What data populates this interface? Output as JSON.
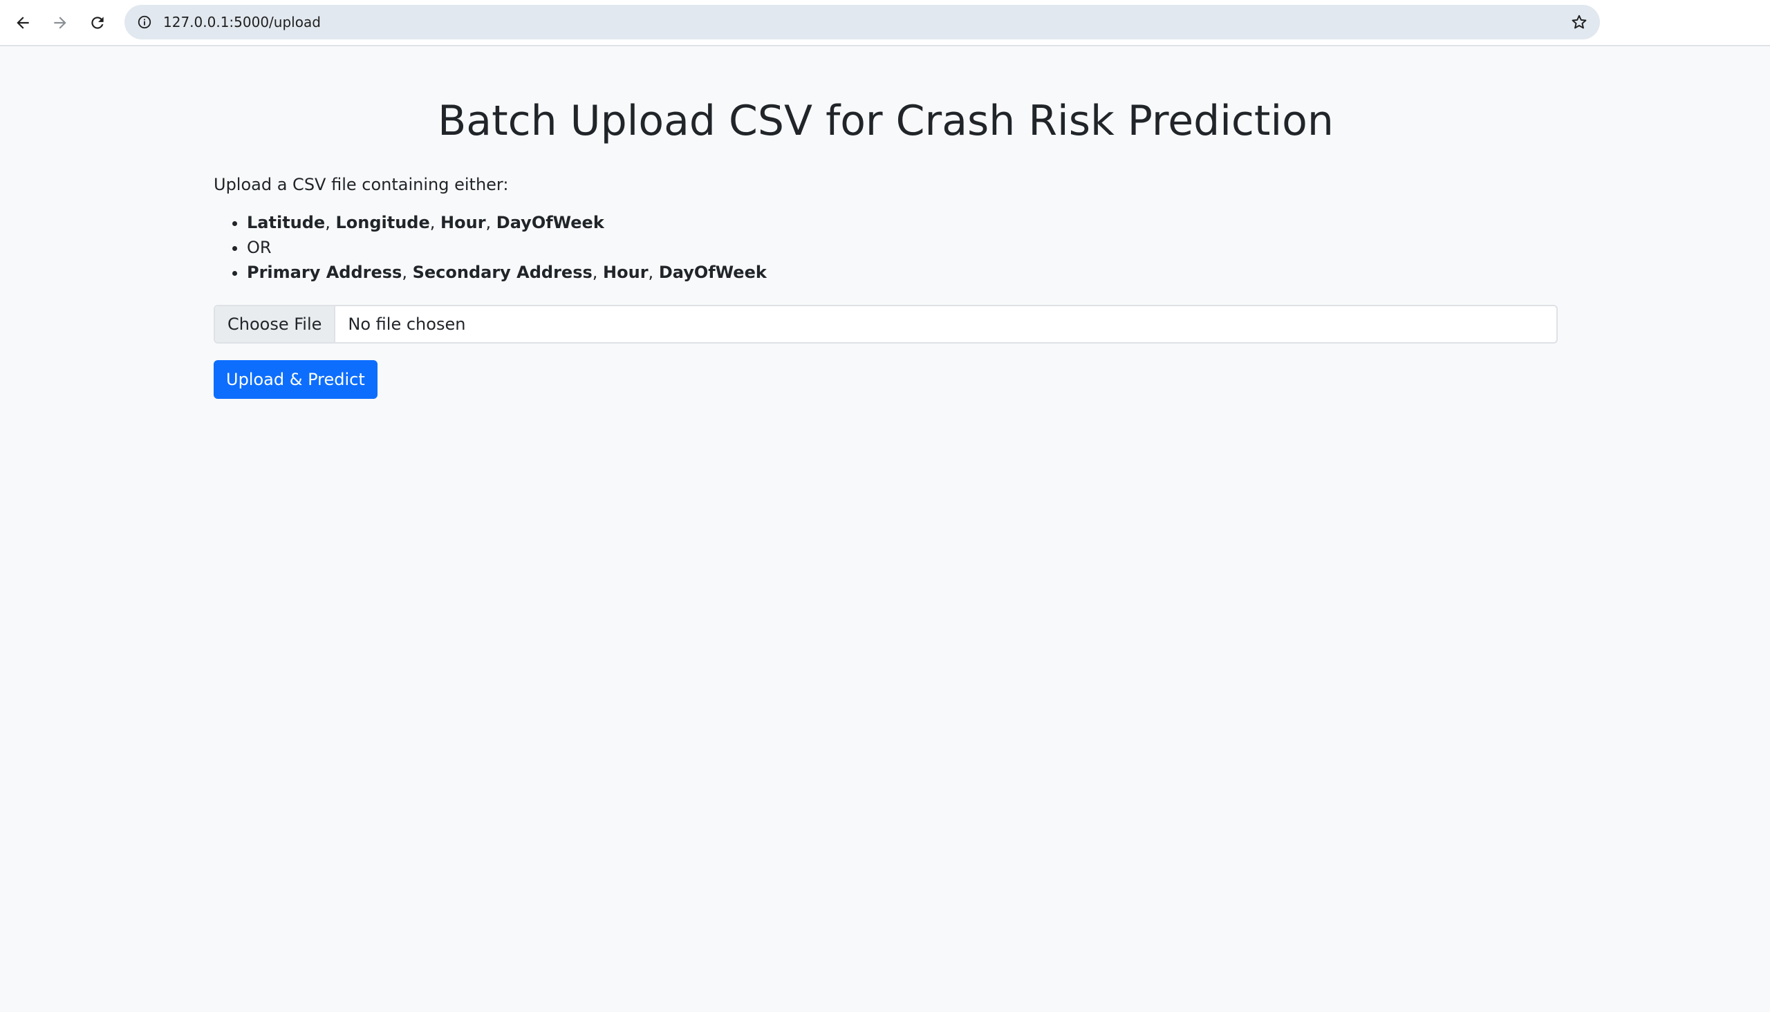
{
  "browser": {
    "url": "127.0.0.1:5000/upload",
    "icons": {
      "back": "arrow-left-icon",
      "forward": "arrow-right-icon",
      "reload": "reload-icon",
      "site_info": "info-icon",
      "bookmark": "star-icon"
    }
  },
  "page": {
    "title": "Batch Upload CSV for Crash Risk Prediction",
    "intro": "Upload a CSV file containing either:",
    "options": {
      "first": [
        "Latitude",
        "Longitude",
        "Hour",
        "DayOfWeek"
      ],
      "separator": "OR",
      "second": [
        "Primary Address",
        "Secondary Address",
        "Hour",
        "DayOfWeek"
      ]
    },
    "separators": [
      ", ",
      ", ",
      ", "
    ],
    "file_input": {
      "button_label": "Choose File",
      "status": "No file chosen"
    },
    "submit_label": "Upload & Predict"
  },
  "colors": {
    "background": "#f8f9fa",
    "primary": "#0d6efd",
    "address_bar": "#e1e8ef"
  }
}
